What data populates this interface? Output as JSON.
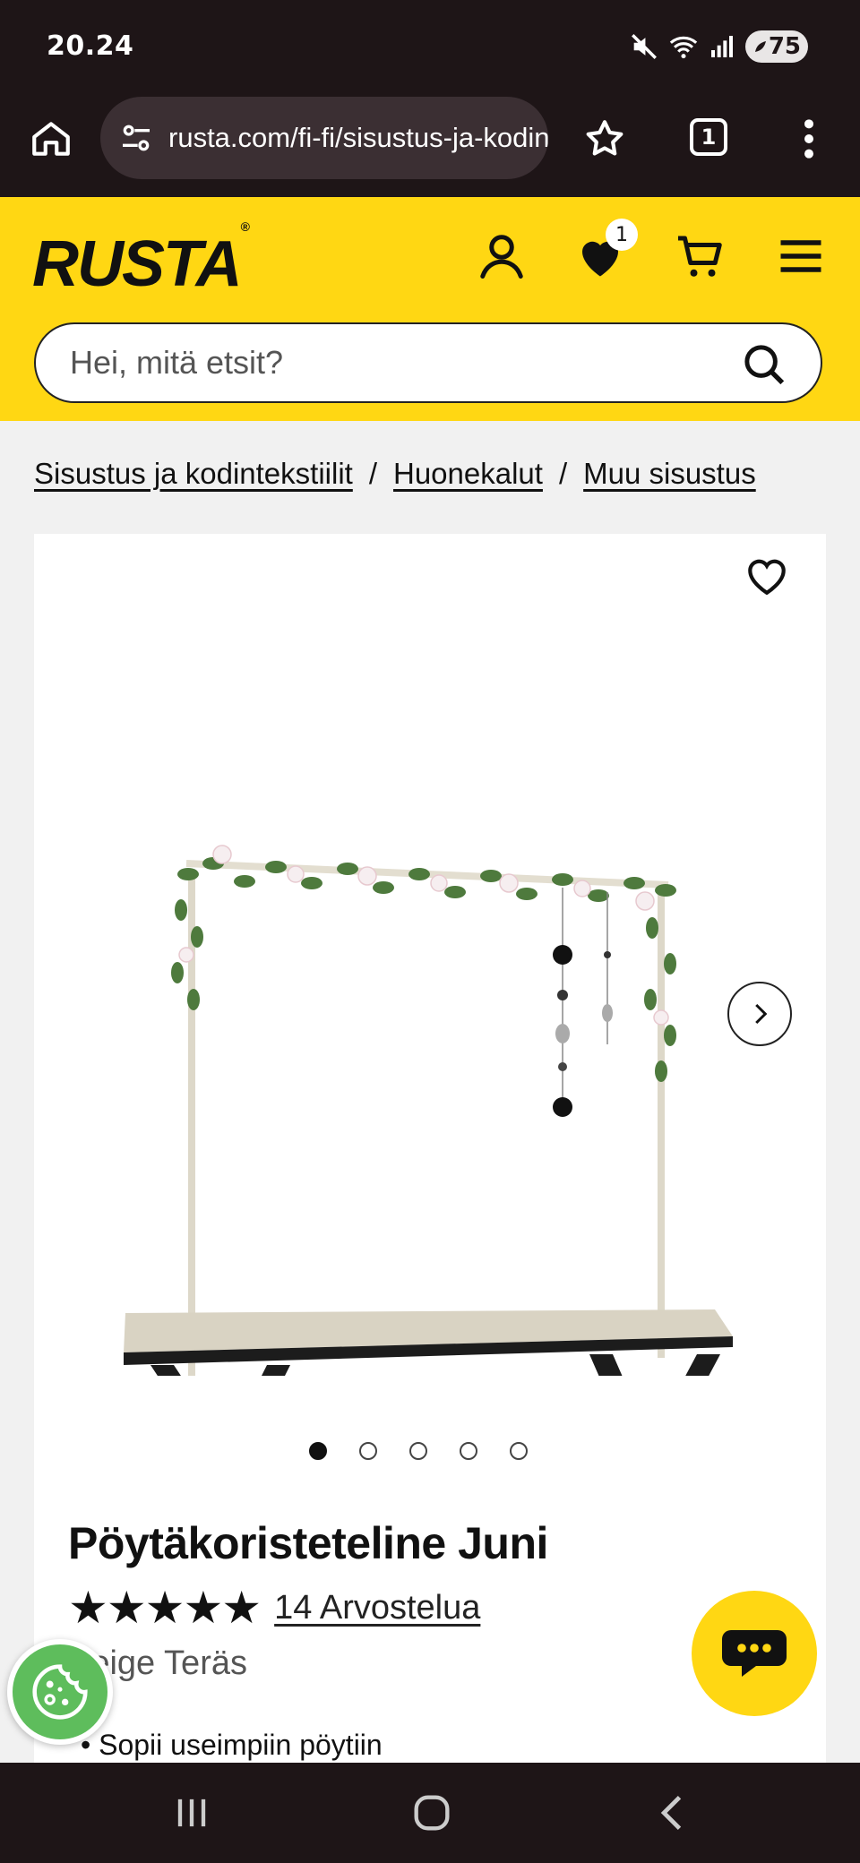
{
  "status_bar": {
    "time": "20.24",
    "battery": "75"
  },
  "browser": {
    "url": "rusta.com/fi-fi/sisustus-ja-kodintekstiilit/huonekalut/muu-sisustus",
    "tab_count": "1"
  },
  "header": {
    "logo": "RUSTA",
    "trademark": "®",
    "favorites_count": "1",
    "search_placeholder": "Hei, mitä etsit?"
  },
  "breadcrumb": [
    "Sisustus ja kodintekstiilit",
    "Huonekalut",
    "Muu sisustus"
  ],
  "breadcrumb_separator": "/",
  "product": {
    "title": "Pöytäkoristeteline Juni",
    "rating_stars": "★★★★★",
    "rating_value": 5,
    "reviews": "14 Arvostelua",
    "variant": "Beige Teräs",
    "features": [
      "Sopii useimpiin pöytiin"
    ],
    "image_count": 5,
    "active_image": 1
  },
  "colors": {
    "brand_yellow": "#ffd713",
    "dark": "#1e1517"
  }
}
